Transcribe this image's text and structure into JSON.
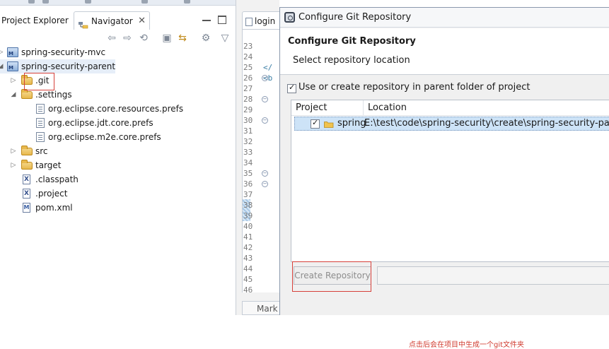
{
  "left_panel": {
    "tabs": {
      "project_explorer": "Project Explorer",
      "navigator": "Navigator"
    },
    "tree": [
      {
        "label": "spring-security-mvc",
        "kind": "project"
      },
      {
        "label": "spring-security-parent",
        "kind": "project"
      },
      {
        "label": ".git",
        "kind": "folder"
      },
      {
        "label": ".settings",
        "kind": "folder"
      },
      {
        "label": "org.eclipse.core.resources.prefs",
        "kind": "file"
      },
      {
        "label": "org.eclipse.jdt.core.prefs",
        "kind": "file"
      },
      {
        "label": "org.eclipse.m2e.core.prefs",
        "kind": "file"
      },
      {
        "label": "src",
        "kind": "folder"
      },
      {
        "label": "target",
        "kind": "folder"
      },
      {
        "label": ".classpath",
        "kind": "xml"
      },
      {
        "label": ".project",
        "kind": "xml"
      },
      {
        "label": "pom.xml",
        "kind": "maven"
      }
    ]
  },
  "editor": {
    "tab_label": "login",
    "line_numbers": [
      "23",
      "24",
      "25",
      "26",
      "27",
      "28",
      "29",
      "30",
      "31",
      "32",
      "33",
      "34",
      "35",
      "36",
      "37",
      "38",
      "39",
      "40",
      "41",
      "42",
      "43",
      "44",
      "45",
      "46"
    ],
    "code_fragments": {
      "line_26": "</",
      "line_27": "<b"
    },
    "bottom_tab_label": "Mark"
  },
  "dialog": {
    "window_title": "Configure Git Repository",
    "heading": "Configure Git Repository",
    "subtitle": "Select repository location",
    "use_parent_checkbox_label": "Use or create repository in parent folder of project",
    "use_parent_checked": true,
    "table": {
      "columns": [
        "Project",
        "Location"
      ],
      "rows": [
        {
          "project": "spring",
          "location": "E:\\test\\code\\spring-security\\create\\spring-security-parent",
          "checked": true
        }
      ]
    },
    "annotation": "点击后会在项目中生成一个git文件夹",
    "create_button_label": "Create Repository"
  },
  "colors": {
    "annotation_red": "#d13c30",
    "selection_blue": "#cde3f7"
  }
}
